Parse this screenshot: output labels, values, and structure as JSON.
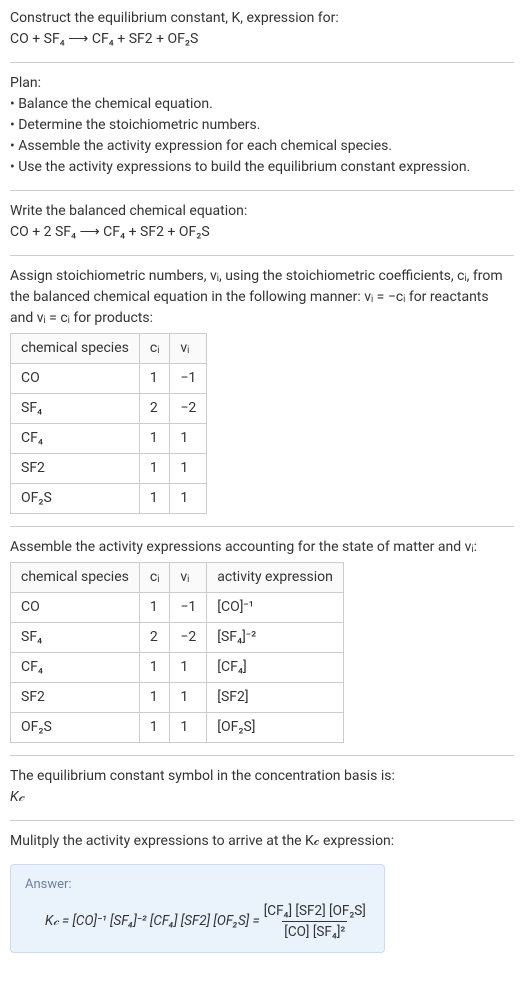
{
  "title_line1": "Construct the equilibrium constant, K, expression for:",
  "title_line2": "CO + SF₄ ⟶ CF₄ + SF2 + OF₂S",
  "plan_header": "Plan:",
  "plan_items": [
    "• Balance the chemical equation.",
    "• Determine the stoichiometric numbers.",
    "• Assemble the activity expression for each chemical species.",
    "• Use the activity expressions to build the equilibrium constant expression."
  ],
  "balanced_header": "Write the balanced chemical equation:",
  "balanced_eq": "CO + 2 SF₄ ⟶ CF₄ + SF2 + OF₂S",
  "stoich_intro1": "Assign stoichiometric numbers, νᵢ, using the stoichiometric coefficients, cᵢ, from the balanced chemical equation in the following manner: νᵢ = −cᵢ for reactants and νᵢ = cᵢ for products:",
  "table1": {
    "headers": [
      "chemical species",
      "cᵢ",
      "νᵢ"
    ],
    "rows": [
      [
        "CO",
        "1",
        "−1"
      ],
      [
        "SF₄",
        "2",
        "−2"
      ],
      [
        "CF₄",
        "1",
        "1"
      ],
      [
        "SF2",
        "1",
        "1"
      ],
      [
        "OF₂S",
        "1",
        "1"
      ]
    ]
  },
  "activity_header": "Assemble the activity expressions accounting for the state of matter and νᵢ:",
  "table2": {
    "headers": [
      "chemical species",
      "cᵢ",
      "νᵢ",
      "activity expression"
    ],
    "rows": [
      [
        "CO",
        "1",
        "−1",
        "[CO]⁻¹"
      ],
      [
        "SF₄",
        "2",
        "−2",
        "[SF₄]⁻²"
      ],
      [
        "CF₄",
        "1",
        "1",
        "[CF₄]"
      ],
      [
        "SF2",
        "1",
        "1",
        "[SF2]"
      ],
      [
        "OF₂S",
        "1",
        "1",
        "[OF₂S]"
      ]
    ]
  },
  "kc_symbol_header": "The equilibrium constant symbol in the concentration basis is:",
  "kc_symbol": "K𝒸",
  "multiply_header": "Mulitply the activity expressions to arrive at the K𝒸 expression:",
  "answer": {
    "label": "Answer:",
    "lhs": "K𝒸 = [CO]⁻¹ [SF₄]⁻² [CF₄] [SF2] [OF₂S] = ",
    "numerator": "[CF₄] [SF2] [OF₂S]",
    "denominator": "[CO] [SF₄]²"
  },
  "chart_data": {
    "type": "table",
    "tables": [
      {
        "title": "Stoichiometric numbers",
        "columns": [
          "chemical species",
          "c_i",
          "nu_i"
        ],
        "rows": [
          {
            "chemical species": "CO",
            "c_i": 1,
            "nu_i": -1
          },
          {
            "chemical species": "SF4",
            "c_i": 2,
            "nu_i": -2
          },
          {
            "chemical species": "CF4",
            "c_i": 1,
            "nu_i": 1
          },
          {
            "chemical species": "SF2",
            "c_i": 1,
            "nu_i": 1
          },
          {
            "chemical species": "OF2S",
            "c_i": 1,
            "nu_i": 1
          }
        ]
      },
      {
        "title": "Activity expressions",
        "columns": [
          "chemical species",
          "c_i",
          "nu_i",
          "activity expression"
        ],
        "rows": [
          {
            "chemical species": "CO",
            "c_i": 1,
            "nu_i": -1,
            "activity expression": "[CO]^-1"
          },
          {
            "chemical species": "SF4",
            "c_i": 2,
            "nu_i": -2,
            "activity expression": "[SF4]^-2"
          },
          {
            "chemical species": "CF4",
            "c_i": 1,
            "nu_i": 1,
            "activity expression": "[CF4]"
          },
          {
            "chemical species": "SF2",
            "c_i": 1,
            "nu_i": 1,
            "activity expression": "[SF2]"
          },
          {
            "chemical species": "OF2S",
            "c_i": 1,
            "nu_i": 1,
            "activity expression": "[OF2S]"
          }
        ]
      }
    ]
  }
}
